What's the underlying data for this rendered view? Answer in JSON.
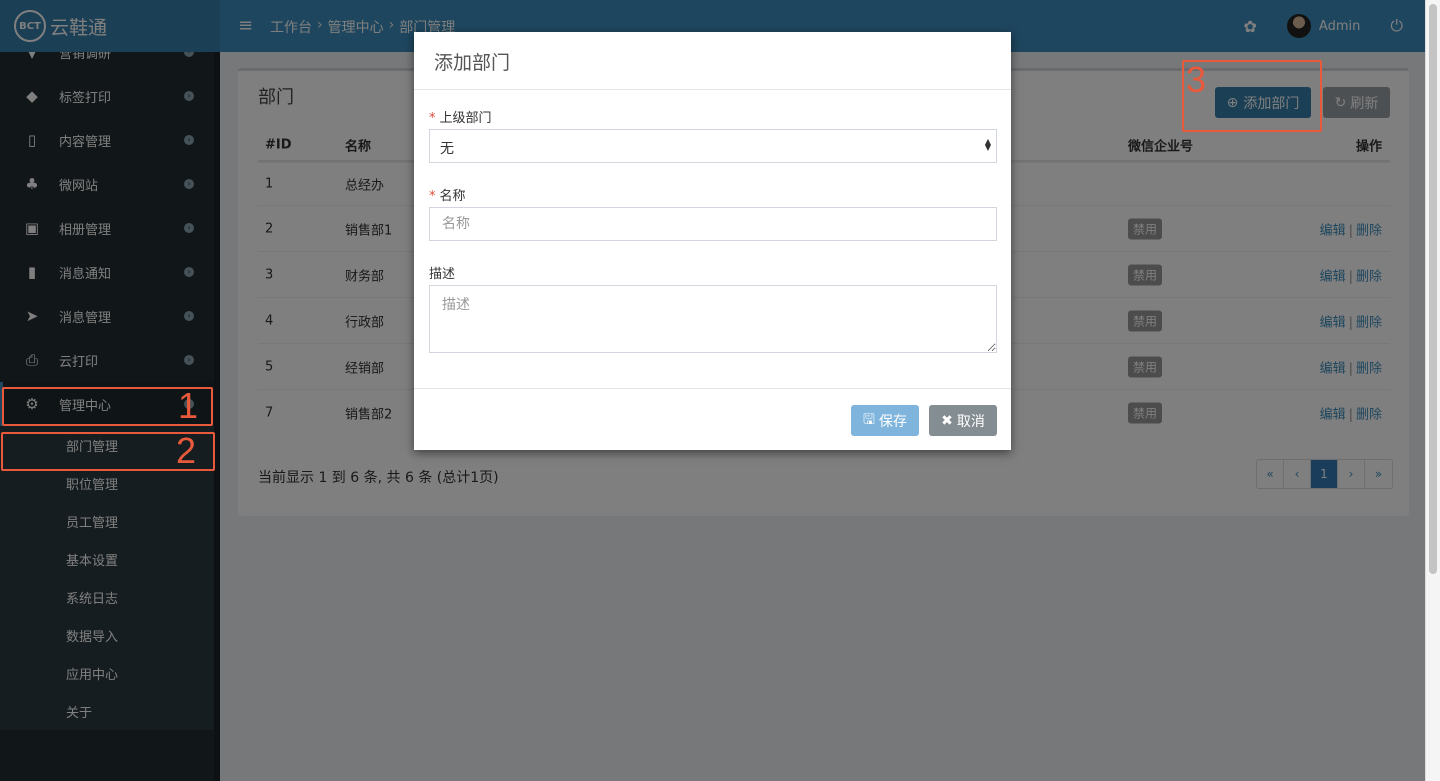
{
  "header": {
    "brand_logo": "BCT",
    "brand_name": "云鞋通",
    "menu_icon": "hamburger-icon",
    "breadcrumb": [
      "工作台",
      "管理中心",
      "部门管理"
    ],
    "breadcrumb_sep": "›",
    "user_name": "Admin",
    "settings_icon": "gear-icon",
    "power_icon": "power-icon"
  },
  "sidebar": {
    "items": [
      {
        "label": "营销调研",
        "icon": "chart-icon"
      },
      {
        "label": "标签打印",
        "icon": "tags-icon"
      },
      {
        "label": "内容管理",
        "icon": "file-icon"
      },
      {
        "label": "微网站",
        "icon": "sitemap-icon"
      },
      {
        "label": "相册管理",
        "icon": "image-icon"
      },
      {
        "label": "消息通知",
        "icon": "building-icon"
      },
      {
        "label": "消息管理",
        "icon": "paper-plane-icon"
      },
      {
        "label": "云打印",
        "icon": "printer-icon"
      },
      {
        "label": "管理中心",
        "icon": "gears-icon"
      }
    ],
    "sub_items": [
      "部门管理",
      "职位管理",
      "员工管理",
      "基本设置",
      "系统日志",
      "数据导入",
      "应用中心",
      "关于"
    ]
  },
  "content": {
    "title": "部门",
    "add_button": "添加部门",
    "refresh_button": "刷新",
    "columns": {
      "id": "#ID",
      "name": "名称",
      "wechat": "微信企业号",
      "ops": "操作"
    },
    "rows": [
      {
        "id": "1",
        "name": "总经办",
        "badge": "",
        "edit": "",
        "del": ""
      },
      {
        "id": "2",
        "name": "销售部1",
        "badge": "禁用",
        "edit": "编辑",
        "del": "删除"
      },
      {
        "id": "3",
        "name": "财务部",
        "badge": "禁用",
        "edit": "编辑",
        "del": "删除"
      },
      {
        "id": "4",
        "name": "行政部",
        "badge": "禁用",
        "edit": "编辑",
        "del": "删除"
      },
      {
        "id": "5",
        "name": "经销部",
        "badge": "禁用",
        "edit": "编辑",
        "del": "删除"
      },
      {
        "id": "7",
        "name": "销售部2",
        "badge": "禁用",
        "edit": "编辑",
        "del": "删除"
      }
    ],
    "op_separator": "|",
    "footer_info": "当前显示 1 到 6 条, 共 6 条 (总计1页)",
    "pager": [
      "«",
      "‹",
      "1",
      "›",
      "»"
    ],
    "current_page": "1"
  },
  "modal": {
    "title": "添加部门",
    "parent_label": "上级部门",
    "parent_value": "无",
    "name_label": "名称",
    "name_placeholder": "名称",
    "desc_label": "描述",
    "desc_placeholder": "描述",
    "required_mark": "*",
    "save_button": "保存",
    "cancel_button": "取消"
  },
  "annotations": [
    "1",
    "2",
    "3"
  ],
  "colors": {
    "header": "#3c8dbc",
    "sidebar": "#222d32",
    "callout": "#e85a3b",
    "primary_button": "#367fa9"
  }
}
